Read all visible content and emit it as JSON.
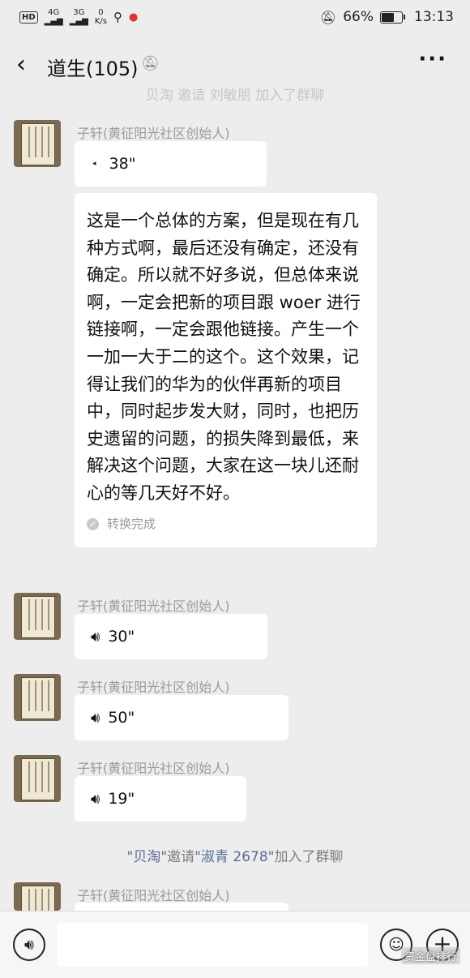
{
  "status_bar": {
    "hd": "HD",
    "net1": "4G",
    "net2": "3G",
    "speed_value": "0",
    "speed_unit": "K/s",
    "battery_percent": "66%",
    "battery_level": 0.66,
    "time": "13:13"
  },
  "header": {
    "back_icon": "chevron-left-icon",
    "title": "道生(105)",
    "mute_icon": "bell-off-icon",
    "more_icon": "more-dots-icon"
  },
  "system_messages": [
    {
      "inviter": "贝淘",
      "verb": "邀请",
      "invitee": "刘敏朋",
      "suffix": "加入了群聊"
    },
    {
      "inviter": "\"贝淘\"",
      "verb": "邀请",
      "invitee": "\"淑青 2678\"",
      "suffix": "加入了群聊"
    }
  ],
  "messages": {
    "sender": "子轩(黄征阳光社区创始人)",
    "voice1": "38\"",
    "transcript": "这是一个总体的方案，但是现在有几种方式啊，最后还没有确定，还没有确定。所以就不好多说，但总体来说啊，一定会把新的项目跟 woer 进行链接啊，一定会跟他链接。产生一个一加一大于二的这个。这个效果，记得让我们的华为的伙伴再新的项目中，同时起步发大财，同时，也把历史遗留的问题，的损失降到最低，来解决这个问题，大家在这一块儿还耐心的等几天好不好。",
    "transcript_status": "转换完成",
    "voice2": "30\"",
    "voice3": "50\"",
    "voice4": "19\""
  },
  "bottom_bar": {
    "voice_icon": "voice-input-icon",
    "input_value": "",
    "emoji_icon": "emoji-icon",
    "plus_icon": "plus-icon"
  },
  "watermark": "资金盘排行"
}
